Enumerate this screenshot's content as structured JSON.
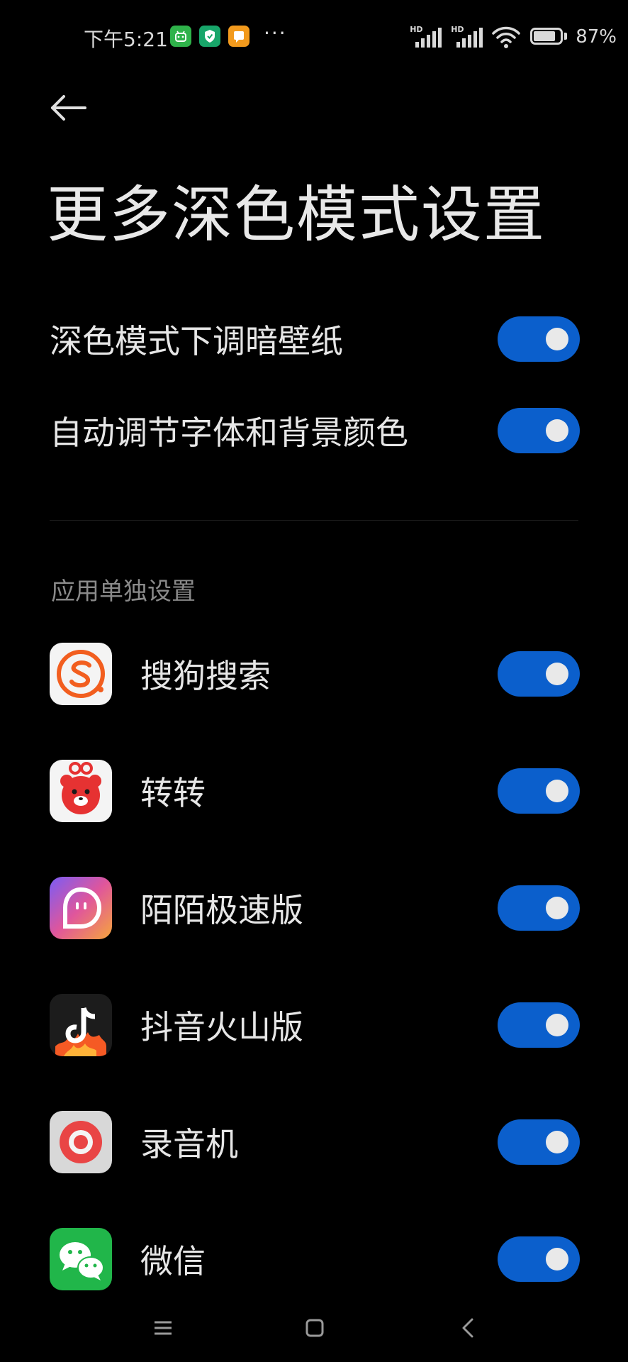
{
  "status_bar": {
    "time": "下午5:21",
    "more": "···",
    "signal_badge": "HD",
    "battery_level": 0.87,
    "battery_text": "87%",
    "app_icons": [
      "android-robot-icon",
      "shield-icon",
      "message-icon"
    ]
  },
  "header": {
    "title": "更多深色模式设置"
  },
  "settings": [
    {
      "label": "深色模式下调暗壁纸",
      "enabled": true
    },
    {
      "label": "自动调节字体和背景颜色",
      "enabled": true
    }
  ],
  "section": {
    "header": "应用单独设置"
  },
  "apps": [
    {
      "name": "搜狗搜索",
      "icon": "sogou-search-icon",
      "enabled": true
    },
    {
      "name": "转转",
      "icon": "zhuanzhuan-icon",
      "enabled": true
    },
    {
      "name": "陌陌极速版",
      "icon": "momo-lite-icon",
      "enabled": true
    },
    {
      "name": "抖音火山版",
      "icon": "douyin-huoshan-icon",
      "enabled": true
    },
    {
      "name": "录音机",
      "icon": "recorder-icon",
      "enabled": true
    },
    {
      "name": "微信",
      "icon": "wechat-icon",
      "enabled": true
    }
  ],
  "colors": {
    "background": "#000000",
    "toggle_on": "#0b5fcc",
    "text_primary": "#e6e6e6",
    "text_secondary": "#8a8a8a"
  }
}
